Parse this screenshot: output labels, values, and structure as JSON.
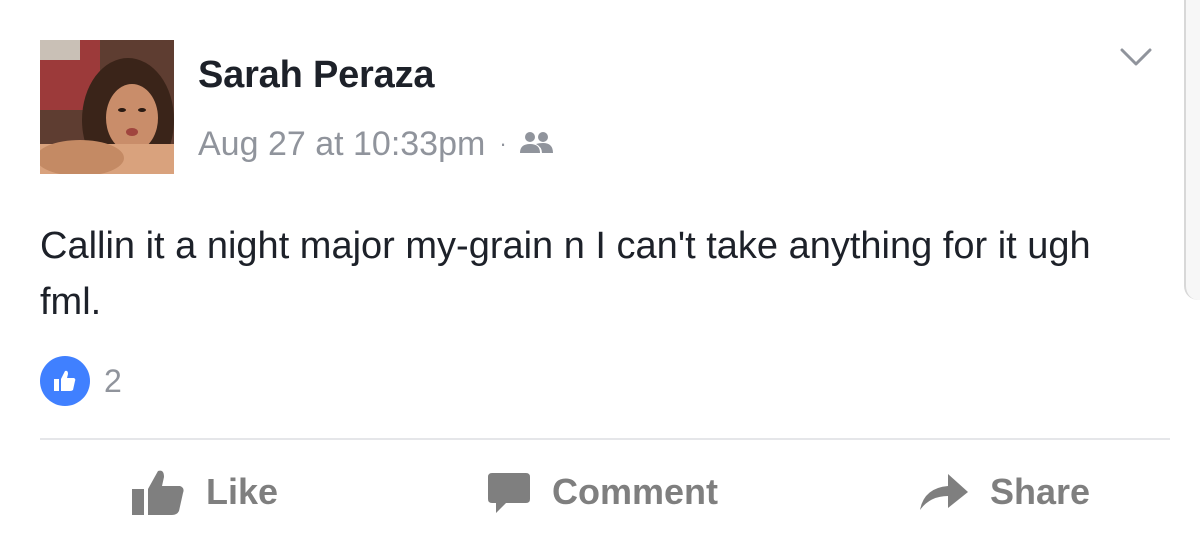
{
  "post": {
    "author": "Sarah Peraza",
    "timestamp": "Aug 27 at 10:33pm",
    "separator": "·",
    "audience_icon": "friends-icon",
    "text": "Callin it a night major my-grain n I can't take anything for it ugh fml.",
    "reactions": {
      "icon": "like-thumb-icon",
      "count": "2"
    },
    "menu_icon": "chevron-down-icon"
  },
  "actions": {
    "like_label": "Like",
    "comment_label": "Comment",
    "share_label": "Share"
  },
  "colors": {
    "like_badge": "#4080ff",
    "name_text": "#1d2129",
    "meta_text": "#90949c",
    "action_text": "#7f7f7f"
  }
}
